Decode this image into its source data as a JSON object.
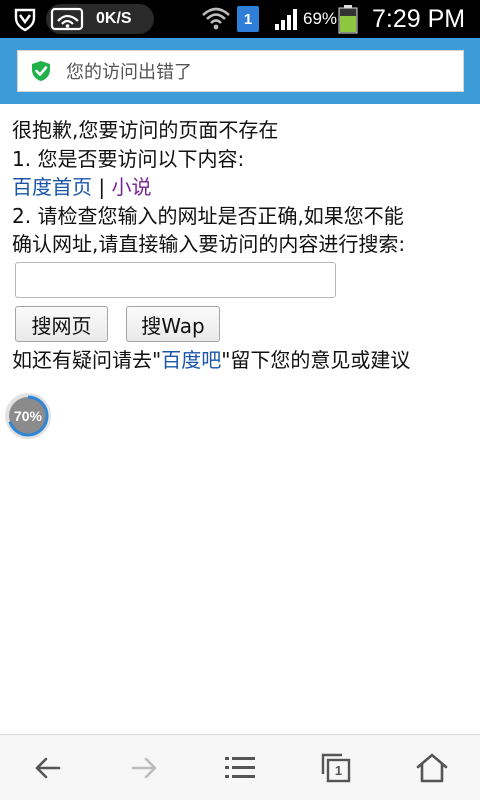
{
  "status_bar": {
    "net_speed": "0K/S",
    "sim_badge": "1",
    "battery": "69%",
    "time": "7:29 PM",
    "icons": [
      "notification-shield-icon",
      "wifi-cloud-icon",
      "wifi-icon",
      "sim-icon",
      "signal-icon",
      "battery-icon"
    ]
  },
  "address_bar": {
    "title": "您的访问出错了",
    "icon": "shield-check-icon",
    "accent": "#3d9cd8"
  },
  "content": {
    "line1": "很抱歉,您要访问的页面不存在",
    "line2": "1. 您是否要访问以下内容:",
    "link_home": "百度首页",
    "separator": " | ",
    "link_novel": "小说",
    "line4": "2. 请检查您输入的网址是否正确,如果您不能",
    "line5": "确认网址,请直接输入要访问的内容进行搜索:",
    "search_value": "",
    "btn_web": "搜网页",
    "btn_wap": "搜Wap",
    "feedback_prefix": "如还有疑问请去\"",
    "feedback_link": "百度吧",
    "feedback_suffix": "\"留下您的意见或建议",
    "link_color": "#1a56a8",
    "visited_color": "#7b2594"
  },
  "progress_ball": {
    "label": "70%",
    "value": 0.7
  },
  "toolbar": {
    "icons": [
      "back-arrow-icon",
      "forward-arrow-icon",
      "menu-list-icon",
      "tabs-icon",
      "home-icon"
    ],
    "tabs_count": "1"
  }
}
